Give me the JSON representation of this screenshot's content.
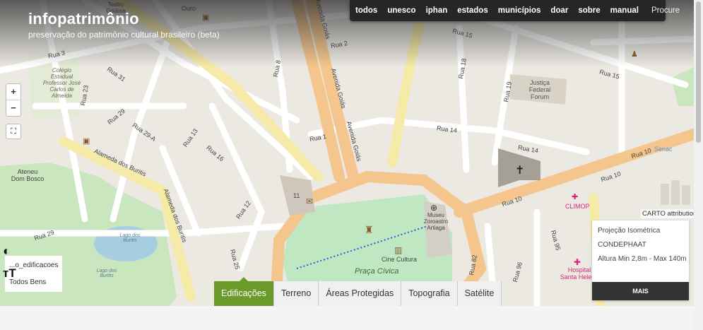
{
  "brand": {
    "title": "infopatrimônio",
    "subtitle": "preservação do patrimônio cultural brasileiro (beta)"
  },
  "nav": {
    "items": [
      "todos",
      "unesco",
      "iphan",
      "estados",
      "municípios",
      "doar",
      "sobre",
      "manual"
    ],
    "search_placeholder": "Procure"
  },
  "map_controls": {
    "zoom_in": "+",
    "zoom_out": "−",
    "fullscreen": "⛶",
    "contrast": "◐",
    "font_size": "ᴛT"
  },
  "layers": {
    "layer_name": "...o_edificacoes",
    "filter": "Todos Bens"
  },
  "tabs": [
    {
      "label": "Edificações",
      "active": true
    },
    {
      "label": "Terreno",
      "active": false
    },
    {
      "label": "Áreas Protegidas",
      "active": false
    },
    {
      "label": "Topografia",
      "active": false
    },
    {
      "label": "Satélite",
      "active": false
    }
  ],
  "attribution": "CARTO attribution",
  "info_panel": {
    "line1": "Projeção Isométrica",
    "line2": "CONDEPHAAT",
    "line3": "Altura Min 2,8m - Max 140m",
    "more_button": "MAIS"
  },
  "map_labels": {
    "rua3": "Rua 3",
    "rua31": "Rua 31",
    "rua2": "Rua 2",
    "rua15a": "Rua 15",
    "rua15b": "Rua 15",
    "rua23": "Rua 23",
    "rua29": "Rua 29",
    "rua294": "Rua 29-A",
    "rua13": "Rua 13",
    "rua16": "Rua 16",
    "rua1": "Rua 1",
    "rua8": "Rua 8",
    "rua14a": "Rua 14",
    "rua14b": "Rua 14",
    "rua18": "Rua 18",
    "rua19": "Rua 19",
    "rua10a": "Rua 10",
    "rua10b": "Rua 10",
    "rua10c": "Rua 10",
    "rua12": "Rua 12",
    "rua25": "Rua 25",
    "rua29b": "Rua 29",
    "rua95": "Rua 95",
    "rua96": "Rua 96",
    "rua82": "Rua 82",
    "av_goias1": "Avenida Goiás",
    "av_goias2": "Avenida Goiás",
    "av_goias3": "Avenida Goiás",
    "alameda1": "Alameda dos Buritis",
    "alameda2": "Alameda dos Buritis",
    "colegio": "Colégio Estadual Professor José Carlos de Almeida",
    "ateneu": "Ateneu Dom Bosco",
    "justica": "Justiça Federal Forum",
    "museu": "Museu Zoroastro Artiaga",
    "cine": "Cine Cultura",
    "praca": "Praça Cívica",
    "lago1": "Lago dos Buritis",
    "lago2": "Lago dos Buritis",
    "clinop": "CLIMOP",
    "hospital": "Hospital Santa Helena",
    "senac": "Senac",
    "teatro": "Teatro Goiânia",
    "ouro": "Ouro",
    "eleven": "11"
  }
}
